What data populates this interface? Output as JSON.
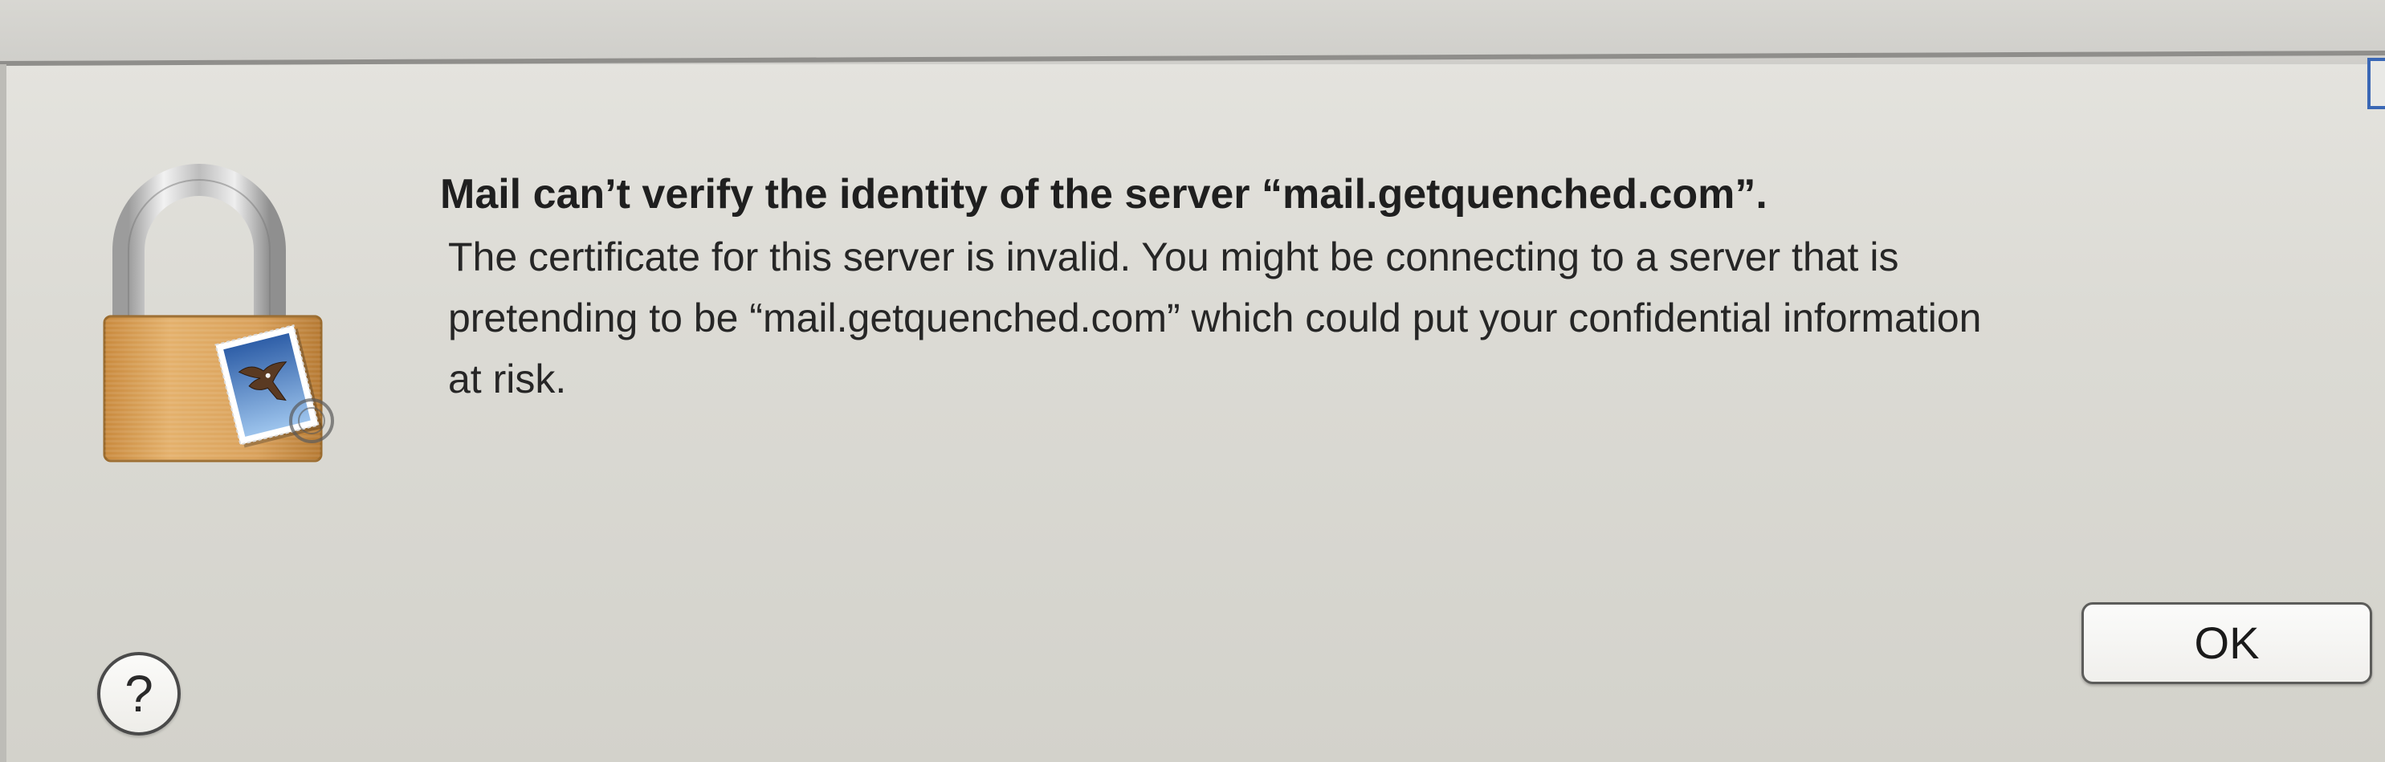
{
  "alert": {
    "app_icon": "mail-lock-icon",
    "title": "Mail can’t verify the identity of the server “mail.getquenched.com”.",
    "message_lines": [
      "The certificate for this server is invalid. You might be connecting to a server that is",
      "pretending to be “mail.getquenched.com” which could put your confidential information",
      "at risk."
    ],
    "ok_button_label": "OK",
    "help_button_label": "?",
    "help_icon": "question-mark-icon"
  },
  "colors": {
    "window_background": "#dcdbd5",
    "lock_body": "#d9a15b",
    "lock_shackle": "#c9c9c9",
    "button_border": "#5c5c5a",
    "focus_accent": "#3a67b5"
  }
}
